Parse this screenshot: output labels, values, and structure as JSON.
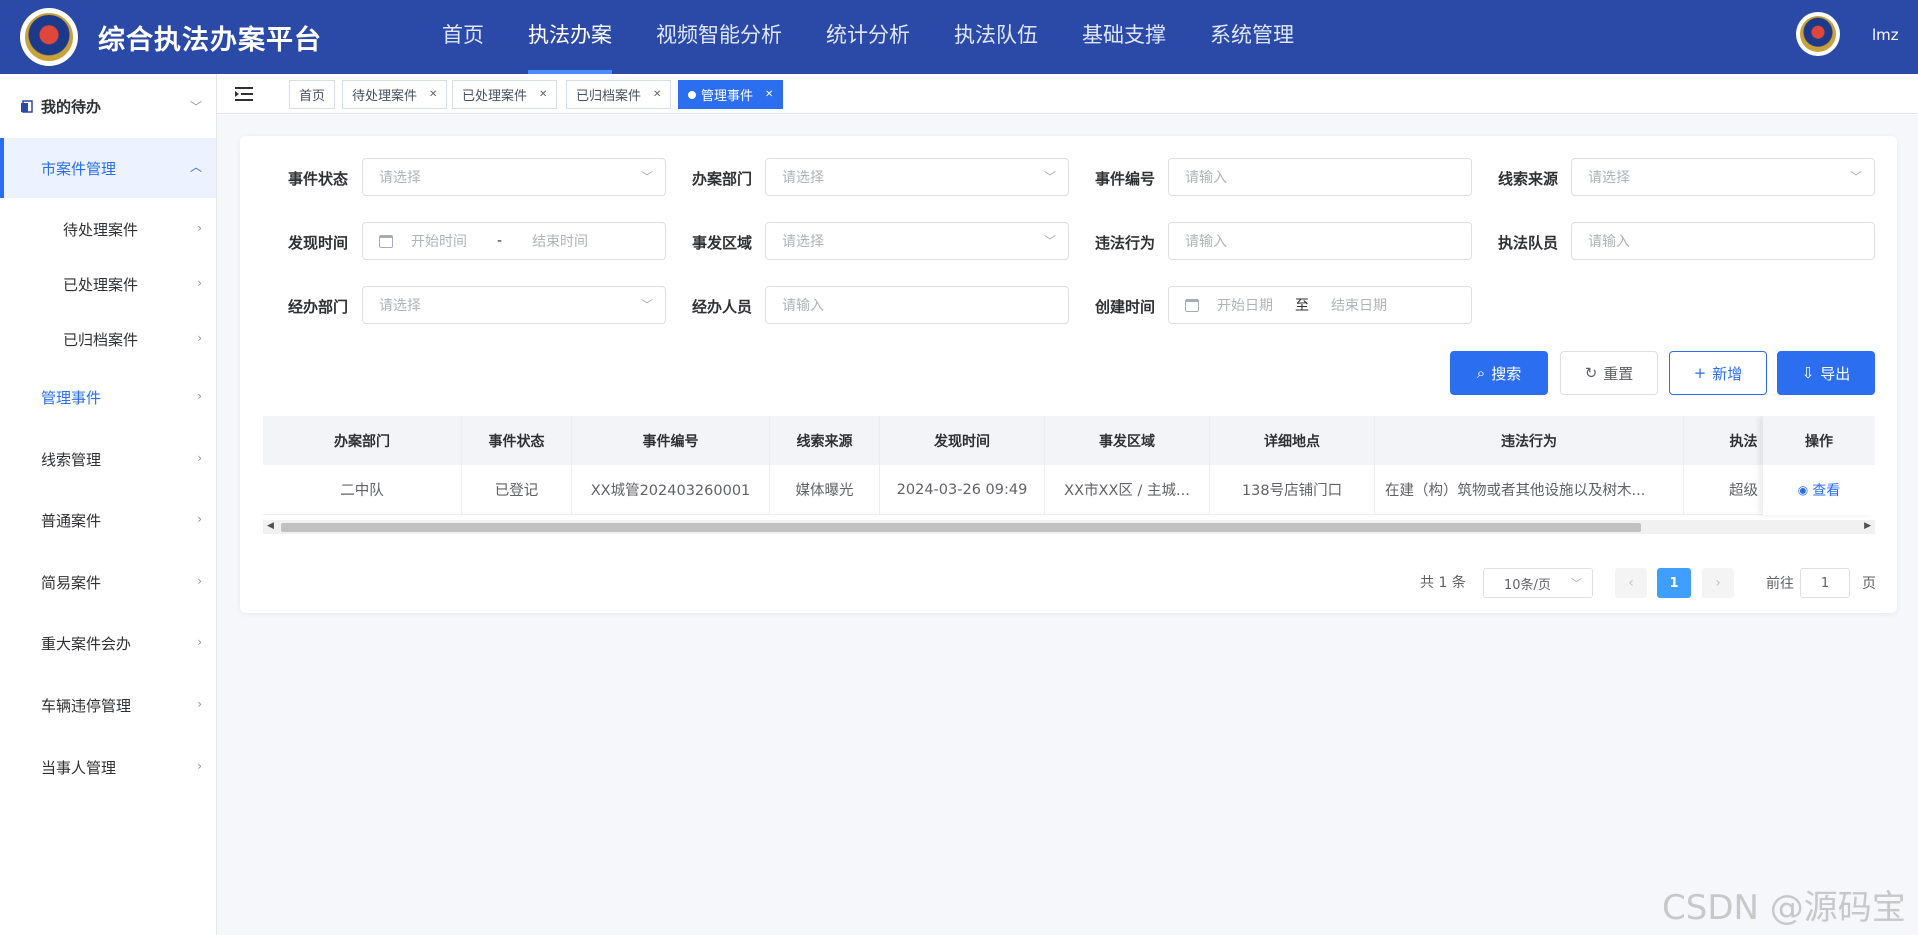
{
  "header": {
    "title": "综合执法办案平台",
    "nav": [
      "首页",
      "执法办案",
      "视频智能分析",
      "统计分析",
      "执法队伍",
      "基础支撑",
      "系统管理"
    ],
    "active_nav": "执法办案",
    "username": "lmz"
  },
  "sidebar": {
    "items": [
      {
        "label": "我的待办"
      },
      {
        "label": "市案件管理"
      },
      {
        "label": "待处理案件"
      },
      {
        "label": "已处理案件"
      },
      {
        "label": "已归档案件"
      },
      {
        "label": "管理事件"
      },
      {
        "label": "线索管理"
      },
      {
        "label": "普通案件"
      },
      {
        "label": "简易案件"
      },
      {
        "label": "重大案件会办"
      },
      {
        "label": "车辆违停管理"
      },
      {
        "label": "当事人管理"
      }
    ]
  },
  "tags": [
    {
      "label": "首页"
    },
    {
      "label": "待处理案件"
    },
    {
      "label": "已处理案件"
    },
    {
      "label": "已归档案件"
    },
    {
      "label": "管理事件"
    }
  ],
  "filters": {
    "event_status": {
      "label": "事件状态",
      "placeholder": "请选择"
    },
    "dept": {
      "label": "办案部门",
      "placeholder": "请选择"
    },
    "event_no": {
      "label": "事件编号",
      "placeholder": "请输入"
    },
    "clue_source": {
      "label": "线索来源",
      "placeholder": "请选择"
    },
    "found_time": {
      "label": "发现时间",
      "start": "开始时间",
      "sep": "-",
      "end": "结束时间"
    },
    "area": {
      "label": "事发区域",
      "placeholder": "请选择"
    },
    "violation": {
      "label": "违法行为",
      "placeholder": "请输入"
    },
    "member": {
      "label": "执法队员",
      "placeholder": "请输入"
    },
    "handle_dept": {
      "label": "经办部门",
      "placeholder": "请选择"
    },
    "handler": {
      "label": "经办人员",
      "placeholder": "请输入"
    },
    "create_time": {
      "label": "创建时间",
      "start": "开始日期",
      "sep": "至",
      "end": "结束日期"
    }
  },
  "buttons": {
    "search": "搜索",
    "reset": "重置",
    "add": "新增",
    "export": "导出"
  },
  "table": {
    "columns": [
      "办案部门",
      "事件状态",
      "事件编号",
      "线索来源",
      "发现时间",
      "事发区域",
      "详细地点",
      "违法行为",
      "执法"
    ],
    "op_header": "操作",
    "rows": [
      {
        "cells": [
          "二中队",
          "已登记",
          "XX城管202403260001",
          "媒体曝光",
          "2024-03-26 09:49",
          "XX市XX区 / 主城...",
          "138号店铺门口",
          "在建（构）筑物或者其他设施以及树木...",
          "超级"
        ],
        "op": "查看"
      }
    ]
  },
  "pagination": {
    "total": "共 1 条",
    "page_size": "10条/页",
    "current": "1",
    "goto_label": "前往",
    "goto_value": "1",
    "page_suffix": "页"
  },
  "watermark": "CSDN @源码宝",
  "colors": {
    "header_bg": "#2b4aa8",
    "primary": "#2b6ff0"
  }
}
